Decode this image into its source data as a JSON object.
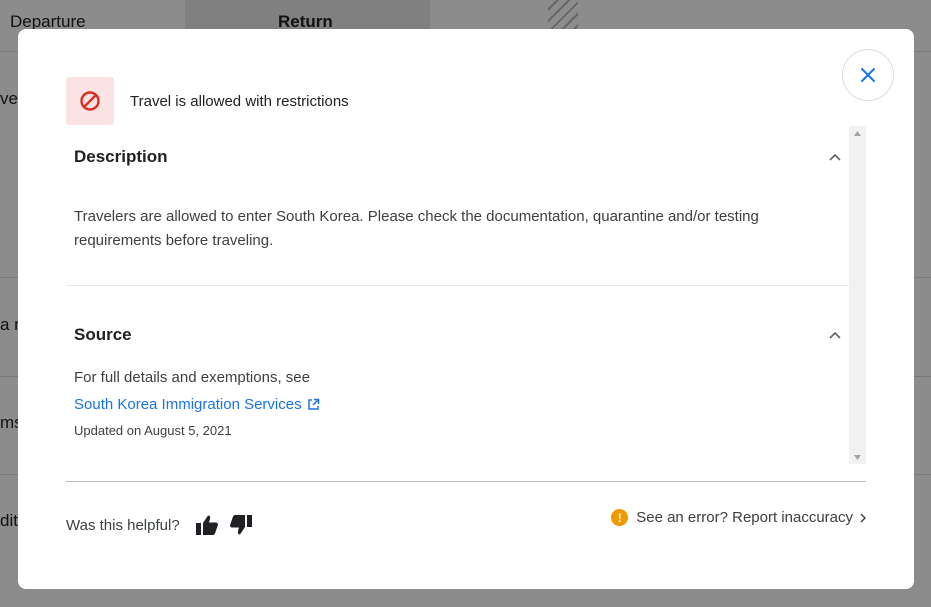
{
  "background": {
    "tabs": [
      "Departure",
      "Return"
    ],
    "fragments": [
      "vel",
      "a n",
      "ms",
      "diti"
    ]
  },
  "modal": {
    "status": {
      "text": "Travel is allowed with restrictions",
      "icon": "no-entry-icon",
      "color": "#d93025"
    },
    "description": {
      "title": "Description",
      "text": "Travelers are allowed to enter South Korea. Please check the documentation, quarantine and/or testing requirements before traveling."
    },
    "source": {
      "title": "Source",
      "intro": "For full details and exemptions, see",
      "link_label": "South Korea Immigration Services",
      "updated": "Updated on August 5, 2021"
    },
    "feedback": {
      "question": "Was this helpful?",
      "report_label": "See an error? Report inaccuracy",
      "warn_glyph": "!"
    },
    "colors": {
      "link": "#1a73e8",
      "warning": "#f29900",
      "close": "#1a73e8"
    }
  }
}
